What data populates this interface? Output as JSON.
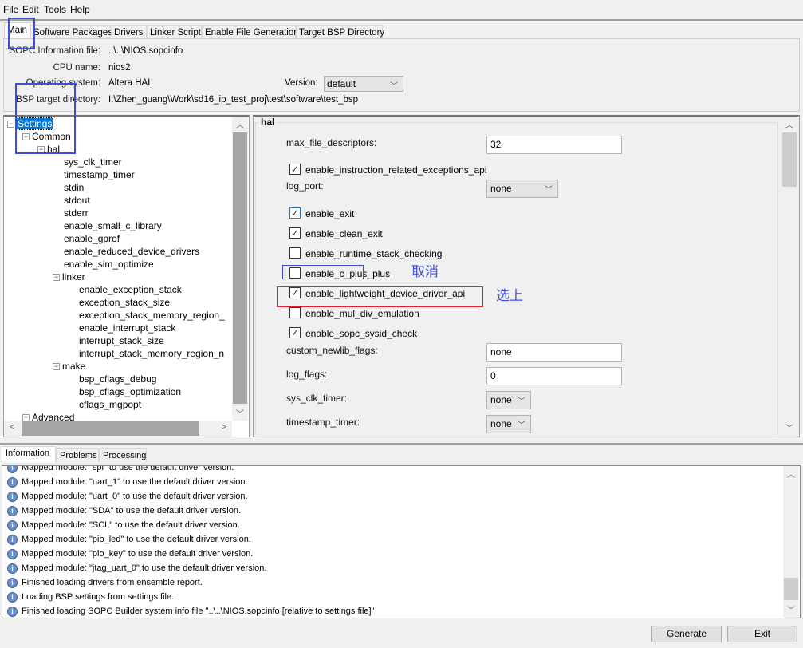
{
  "menu": [
    "File",
    "Edit",
    "Tools",
    "Help"
  ],
  "tabs": [
    "Main",
    "Software Packages",
    "Drivers",
    "Linker Script",
    "Enable File Generation",
    "Target BSP Directory"
  ],
  "info": {
    "sopc_label": "SOPC Information file:",
    "sopc_value": "..\\..\\NIOS.sopcinfo",
    "cpu_label": "CPU name:",
    "cpu_value": "nios2",
    "os_label": "Operating system:",
    "os_value": "Altera HAL",
    "version_label": "Version:",
    "version_value": "default",
    "bsp_label": "BSP target directory:",
    "bsp_value": "I:\\Zhen_guang\\Work\\sd16_ip_test_proj\\test\\software\\test_bsp"
  },
  "tree": [
    {
      "label": "Settings",
      "level": 0,
      "toggle": "-",
      "selected": true
    },
    {
      "label": "Common",
      "level": 1,
      "toggle": "-"
    },
    {
      "label": "hal",
      "level": 2,
      "toggle": "-"
    },
    {
      "label": "sys_clk_timer",
      "level": 3
    },
    {
      "label": "timestamp_timer",
      "level": 3
    },
    {
      "label": "stdin",
      "level": 3
    },
    {
      "label": "stdout",
      "level": 3
    },
    {
      "label": "stderr",
      "level": 3
    },
    {
      "label": "enable_small_c_library",
      "level": 3
    },
    {
      "label": "enable_gprof",
      "level": 3
    },
    {
      "label": "enable_reduced_device_drivers",
      "level": 3
    },
    {
      "label": "enable_sim_optimize",
      "level": 3
    },
    {
      "label": "linker",
      "level": 3,
      "toggle": "-"
    },
    {
      "label": "enable_exception_stack",
      "level": 4
    },
    {
      "label": "exception_stack_size",
      "level": 4
    },
    {
      "label": "exception_stack_memory_region_",
      "level": 4
    },
    {
      "label": "enable_interrupt_stack",
      "level": 4
    },
    {
      "label": "interrupt_stack_size",
      "level": 4
    },
    {
      "label": "interrupt_stack_memory_region_n",
      "level": 4
    },
    {
      "label": "make",
      "level": 3,
      "toggle": "-"
    },
    {
      "label": "bsp_cflags_debug",
      "level": 4
    },
    {
      "label": "bsp_cflags_optimization",
      "level": 4
    },
    {
      "label": "cflags_mgpopt",
      "level": 4
    },
    {
      "label": "Advanced",
      "level": 1,
      "toggle": "+"
    }
  ],
  "hal": {
    "title": "hal",
    "max_file_descriptors_label": "max_file_descriptors:",
    "max_file_descriptors": "32",
    "log_port_label": "log_port:",
    "log_port": "none",
    "custom_newlib_flags_label": "custom_newlib_flags:",
    "custom_newlib_flags": "none",
    "log_flags_label": "log_flags:",
    "log_flags": "0",
    "sys_clk_timer_label": "sys_clk_timer:",
    "sys_clk_timer": "none",
    "timestamp_timer_label": "timestamp_timer:",
    "timestamp_timer": "none",
    "checkboxes": [
      {
        "label": "enable_instruction_related_exceptions_api",
        "checked": true
      },
      {
        "label": "enable_exit",
        "checked": true
      },
      {
        "label": "enable_clean_exit",
        "checked": true
      },
      {
        "label": "enable_runtime_stack_checking",
        "checked": false
      },
      {
        "label": "enable_c_plus_plus",
        "checked": false
      },
      {
        "label": "enable_lightweight_device_driver_api",
        "checked": true
      },
      {
        "label": "enable_mul_div_emulation",
        "checked": false
      },
      {
        "label": "enable_sopc_sysid_check",
        "checked": true
      }
    ]
  },
  "annotations": {
    "cancel": "取消",
    "select": "选上",
    "colors": {
      "blue": "#3d4fd6",
      "red": "#e0202a"
    }
  },
  "bottom_tabs": [
    "Information",
    "Problems",
    "Processing"
  ],
  "log": [
    "Mapped module: \"spi\" to use the default driver version.",
    "Mapped module: \"uart_1\" to use the default driver version.",
    "Mapped module: \"uart_0\" to use the default driver version.",
    "Mapped module: \"SDA\" to use the default driver version.",
    "Mapped module: \"SCL\" to use the default driver version.",
    "Mapped module: \"pio_led\" to use the default driver version.",
    "Mapped module: \"pio_key\" to use the default driver version.",
    "Mapped module: \"jtag_uart_0\" to use the default driver version.",
    "Finished loading drivers from ensemble report.",
    "Loading BSP settings from settings file.",
    "Finished loading SOPC Builder system info file \"..\\..\\NIOS.sopcinfo [relative to settings file]\""
  ],
  "buttons": {
    "generate": "Generate",
    "exit": "Exit"
  }
}
